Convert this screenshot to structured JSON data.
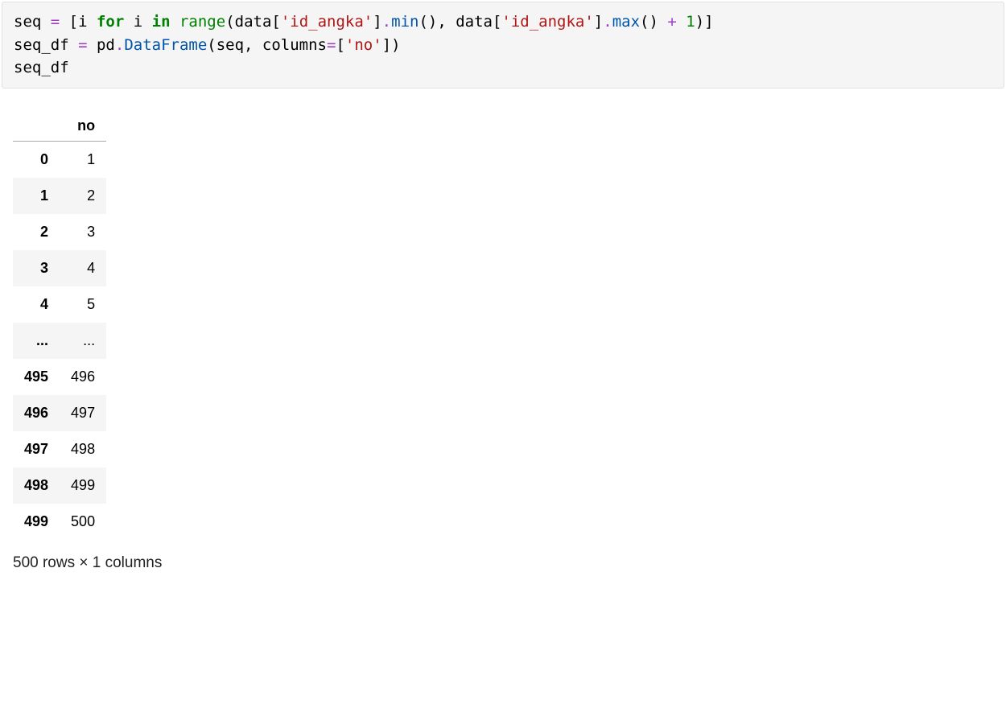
{
  "code": {
    "line1": {
      "p0": "seq ",
      "op_eq": "=",
      "p1": " [i ",
      "kw_for": "for",
      "p2": " i ",
      "kw_in": "in",
      "p3": " ",
      "fn_range": "range",
      "p4": "(data[",
      "str1": "'id_angka'",
      "p5": "]",
      "dot1": ".",
      "fn_min": "min",
      "p6": "(), data[",
      "str2": "'id_angka'",
      "p7": "]",
      "dot2": ".",
      "fn_max": "max",
      "p8": "() ",
      "op_plus": "+",
      "p9": " ",
      "num1": "1",
      "p10": ")]"
    },
    "line2": {
      "p0": "seq_df ",
      "op_eq": "=",
      "p1": " pd",
      "dot1": ".",
      "fn_df": "DataFrame",
      "p2": "(seq, columns",
      "op_eq2": "=",
      "p3": "[",
      "str1": "'no'",
      "p4": "])"
    },
    "line3": {
      "p0": "seq_df"
    }
  },
  "dataframe": {
    "columns": [
      "no"
    ],
    "rows": [
      {
        "idx": "0",
        "no": "1"
      },
      {
        "idx": "1",
        "no": "2"
      },
      {
        "idx": "2",
        "no": "3"
      },
      {
        "idx": "3",
        "no": "4"
      },
      {
        "idx": "4",
        "no": "5"
      },
      {
        "idx": "...",
        "no": "..."
      },
      {
        "idx": "495",
        "no": "496"
      },
      {
        "idx": "496",
        "no": "497"
      },
      {
        "idx": "497",
        "no": "498"
      },
      {
        "idx": "498",
        "no": "499"
      },
      {
        "idx": "499",
        "no": "500"
      }
    ],
    "summary": "500 rows × 1 columns"
  }
}
